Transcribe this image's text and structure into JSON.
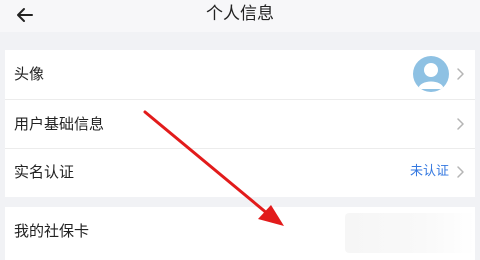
{
  "header": {
    "title": "个人信息"
  },
  "rows": {
    "avatar": {
      "label": "头像"
    },
    "basic_info": {
      "label": "用户基础信息"
    },
    "real_name": {
      "label": "实名认证",
      "status": "未认证"
    },
    "social_card": {
      "label": "我的社保卡"
    }
  },
  "colors": {
    "status_link": "#3478e0",
    "annotation_arrow": "#e21b1b",
    "avatar_bg": "#8ec1e3"
  },
  "icons": {
    "back": "arrow-left-icon",
    "chevron": "chevron-right-icon",
    "avatar": "default-user-avatar-icon"
  }
}
